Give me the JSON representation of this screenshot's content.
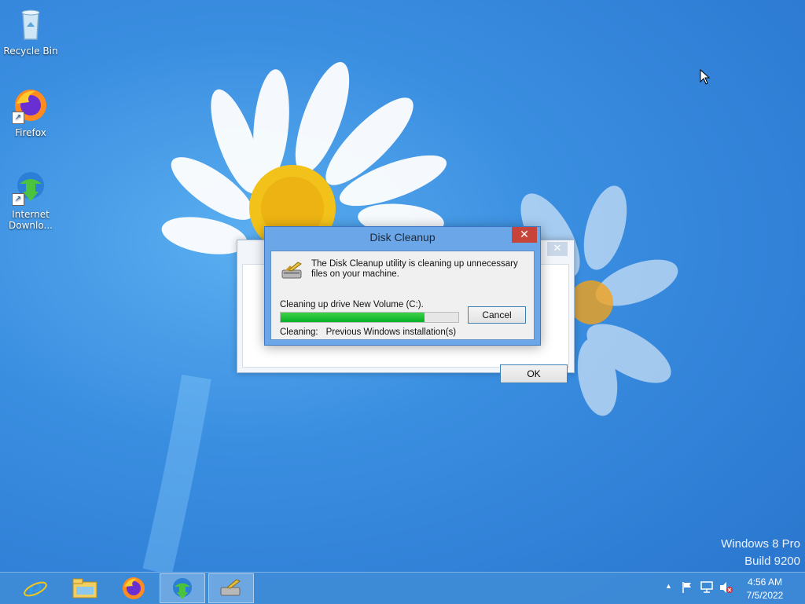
{
  "desktop": {
    "icons": [
      {
        "label": "Recycle Bin"
      },
      {
        "label": "Firefox"
      },
      {
        "label": "Internet Downlo..."
      }
    ],
    "watermark": {
      "line1": "Windows 8 Pro",
      "line2": "Build 9200"
    }
  },
  "background_window": {
    "close_glyph": "✕",
    "ok_label": "OK"
  },
  "dialog": {
    "title": "Disk Cleanup",
    "close_glyph": "✕",
    "message": "The Disk Cleanup utility is cleaning up unnecessary files on your machine.",
    "status": "Cleaning up drive New Volume (C:).",
    "progress": 0.81,
    "cancel_label": "Cancel",
    "cleaning_label": "Cleaning:",
    "cleaning_value": "Previous Windows installation(s)"
  },
  "taskbar": {
    "pinned": [
      {
        "icon": "internet-explorer-icon"
      },
      {
        "icon": "file-explorer-icon"
      },
      {
        "icon": "firefox-icon"
      },
      {
        "icon": "internet-download-manager-icon"
      },
      {
        "icon": "disk-cleanup-icon"
      }
    ],
    "tray": {
      "show_hidden": "▲",
      "time": "4:56 AM",
      "date": "7/5/2022"
    }
  }
}
